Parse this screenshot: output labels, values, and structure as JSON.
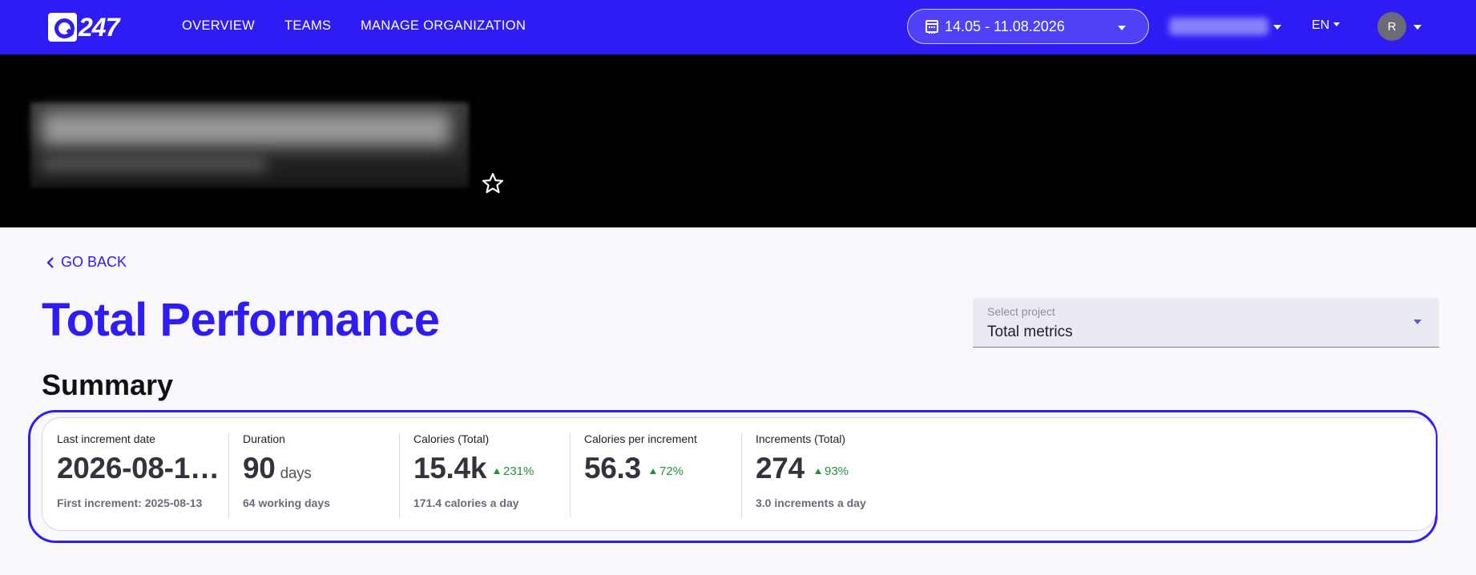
{
  "nav": {
    "logo_text": "247",
    "links": [
      "OVERVIEW",
      "TEAMS",
      "MANAGE ORGANIZATION"
    ],
    "date_range": "14.05 - 11.08.2026",
    "language": "EN",
    "avatar_initial": "R"
  },
  "page": {
    "go_back": "GO BACK",
    "title": "Total Performance",
    "select": {
      "label": "Select project",
      "value": "Total metrics"
    },
    "section_title": "Summary"
  },
  "summary": {
    "metrics": [
      {
        "label": "Last increment date",
        "value": "2026-08-1…",
        "unit": "",
        "change": "",
        "sub": "First increment: 2025-08-13"
      },
      {
        "label": "Duration",
        "value": "90",
        "unit": "days",
        "change": "",
        "sub": "64 working days"
      },
      {
        "label": "Calories (Total)",
        "value": "15.4k",
        "unit": "",
        "change": "231%",
        "sub": "171.4 calories a day"
      },
      {
        "label": "Calories per increment",
        "value": "56.3",
        "unit": "",
        "change": "72%",
        "sub": ""
      },
      {
        "label": "Increments (Total)",
        "value": "274",
        "unit": "",
        "change": "93%",
        "sub": "3.0 increments a day"
      }
    ]
  },
  "colors": {
    "brand": "#2f1cf5",
    "positive": "#21933b",
    "banner": "#000000"
  }
}
